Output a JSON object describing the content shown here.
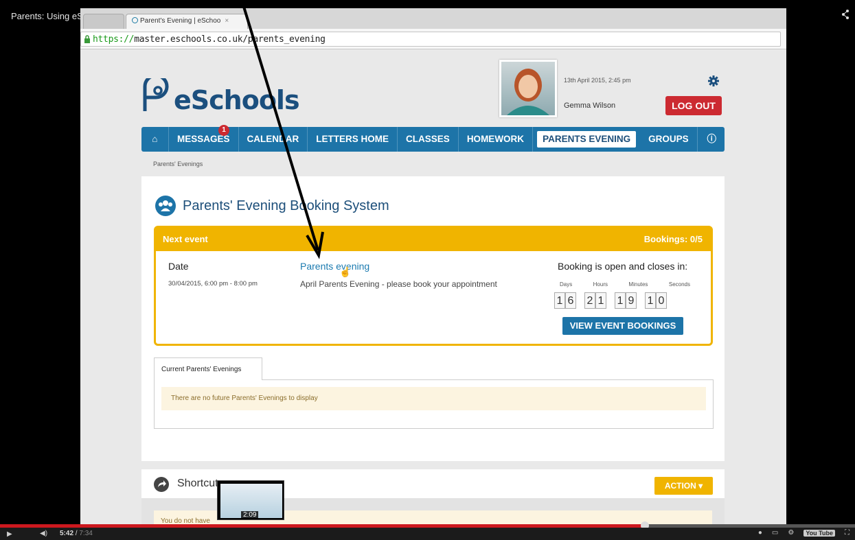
{
  "player": {
    "video_title": "Parents: Using eSchools",
    "time_current": "5:42",
    "time_total": "7:34",
    "progress_fraction": 0.754,
    "preview_time": "2:09",
    "yt_logo": "You Tube"
  },
  "browser": {
    "tabs": [
      {
        "label": "Parent's Evening | eSchoo"
      }
    ],
    "url_scheme": "https://",
    "url_rest": "master.eschools.co.uk/parents_evening"
  },
  "header": {
    "logo_text": "eSchools",
    "datetime": "13th April 2015, 2:45 pm",
    "username": "Gemma Wilson",
    "logout_label": "LOG OUT"
  },
  "nav": {
    "items": [
      {
        "label": "MESSAGES",
        "badge": "1"
      },
      {
        "label": "CALENDAR"
      },
      {
        "label": "LETTERS HOME"
      },
      {
        "label": "CLASSES"
      },
      {
        "label": "HOMEWORK"
      },
      {
        "label": "PARENTS EVENING",
        "active": true
      },
      {
        "label": "GROUPS"
      }
    ]
  },
  "breadcrumb": "Parents' Evenings",
  "main": {
    "title": "Parents' Evening Booking System",
    "next_event_label": "Next event",
    "bookings": "Bookings: 0/5",
    "date_label": "Date",
    "date_value": "30/04/2015, 6:00 pm - 8:00 pm",
    "event_title": "Parents evening",
    "event_desc": "April Parents Evening - please book your appointment",
    "closes_label": "Booking is open and closes in:",
    "timer_labels": [
      "Days",
      "Hours",
      "Minutes",
      "Seconds"
    ],
    "timer_digits": [
      [
        "1",
        "6"
      ],
      [
        "2",
        "1"
      ],
      [
        "1",
        "9"
      ],
      [
        "1",
        "0"
      ]
    ],
    "view_button": "VIEW EVENT BOOKINGS",
    "tab_label": "Current Parents' Evenings",
    "notice": "There are no future Parents' Evenings to display"
  },
  "shortcuts": {
    "title": "Shortcuts",
    "action_label": "ACTION ▾",
    "empty_text": "You do not have"
  },
  "colors": {
    "nav_blue": "#1d74a8",
    "logout_red": "#cc2a31",
    "event_yellow": "#f0b400",
    "progress_red": "#cc181e"
  }
}
